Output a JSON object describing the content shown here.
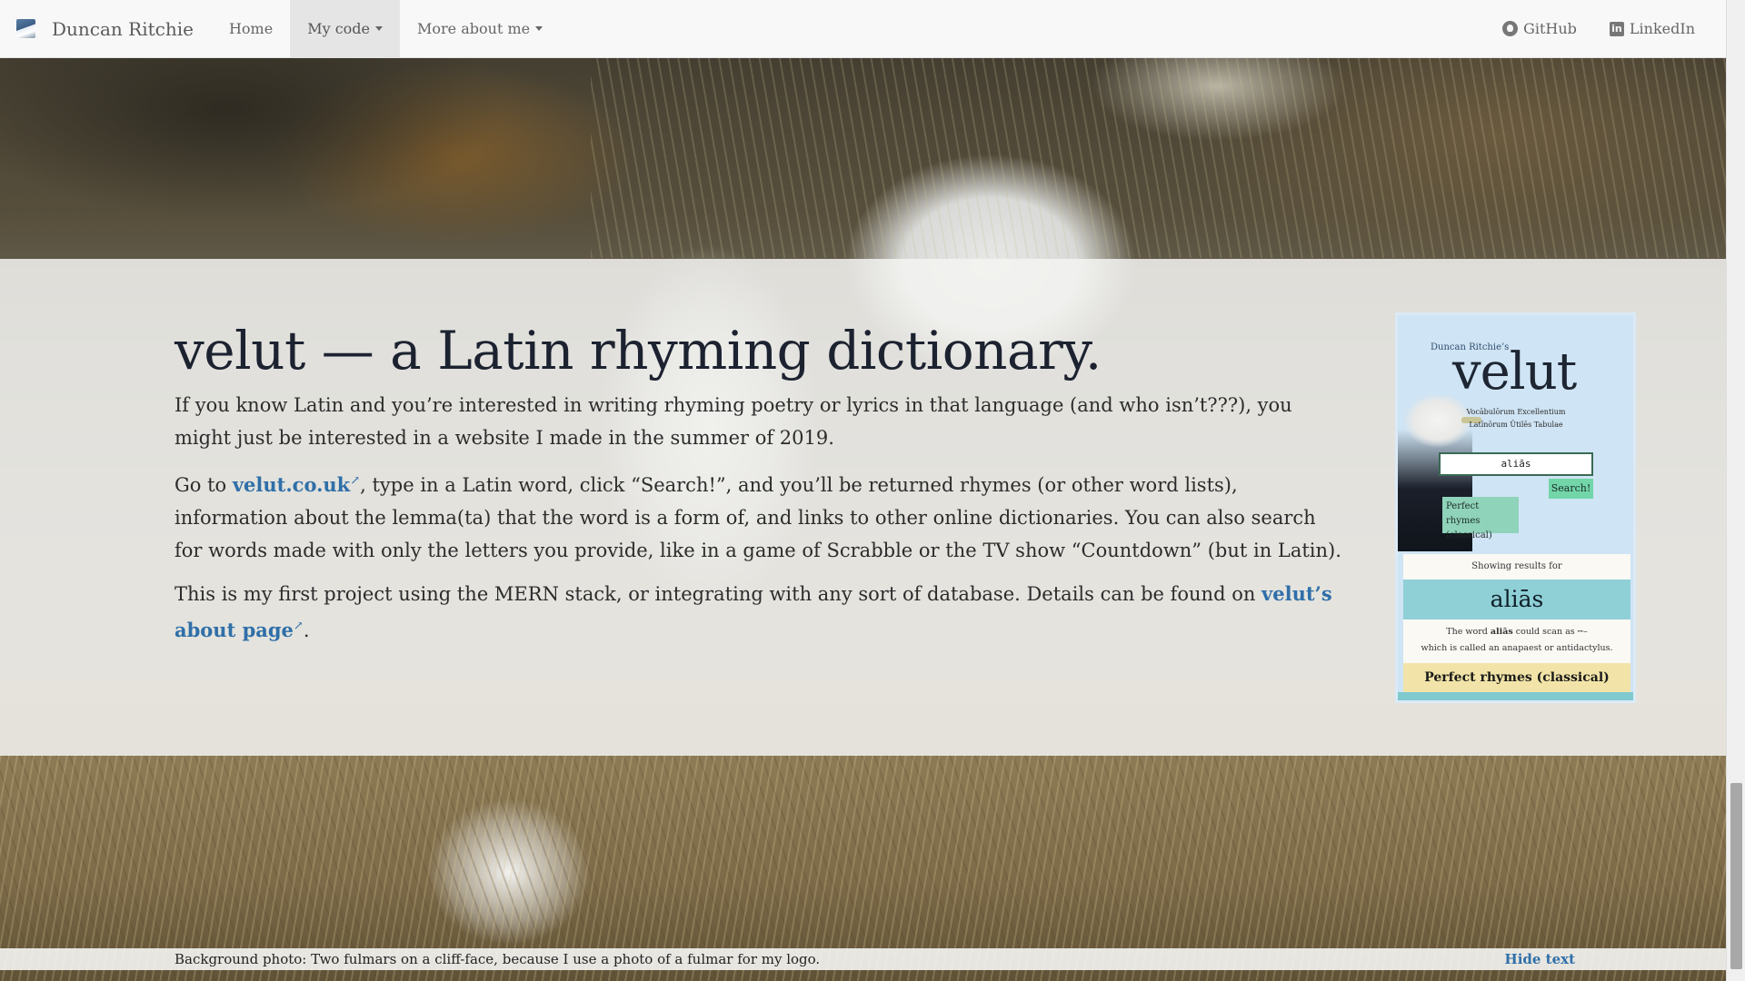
{
  "navbar": {
    "brand": "Duncan Ritchie",
    "items": [
      {
        "label": "Home"
      },
      {
        "label": "My code"
      },
      {
        "label": "More about me"
      }
    ],
    "right": [
      {
        "label": "GitHub",
        "icon": "github-icon"
      },
      {
        "label": "LinkedIn",
        "icon": "linkedin-icon"
      }
    ]
  },
  "main": {
    "title": "velut — a Latin rhyming dictionary.",
    "p1": "If you know Latin and you’re interested in writing rhyming poetry or lyrics in that language (and who isn’t???), you might just be interested in a website I made in the summer of 2019.",
    "p2_prefix": "Go to ",
    "p2_link": "velut.co.uk",
    "p2_suffix": ", type in a Latin word, click “Search!”, and you’ll be returned rhymes (or other word lists), information about the lemma(ta) that the word is a form of, and links to other online dictionaries. You can also search for words made with only the letters you provide, like in a game of Scrabble or the TV show “Countdown” (but in Latin).",
    "p3_prefix": "This is my first project using the MERN stack, or integrating with any sort of database. Details can be found on ",
    "p3_link": "velut’s about page",
    "p3_suffix": ".",
    "external_icon": "↗"
  },
  "preview": {
    "small_label": "Duncan Ritchie’s",
    "logo": "velut",
    "subtitle_1": "Vocābulōrum Excellentium",
    "subtitle_2": "Latīnōrum Ūtilēs Tabulae",
    "input_value": "aliās",
    "search_label": "Search!",
    "option_label_1": "Perfect rhymes",
    "option_label_2": "(classical)",
    "showing": "Showing results for",
    "word": "aliās",
    "scan_1_prefix": "The word ",
    "scan_1_word": "aliās",
    "scan_1_suffix": " could scan as ⏑⏑–",
    "scan_2": "which is called an anapaest or antidactylus.",
    "rhymes_heading": "Perfect rhymes (classical)"
  },
  "caption": {
    "text": "Background photo: Two fulmars on a cliff-face, because I use a photo of a fulmar for my logo.",
    "hide_label": "Hide text"
  }
}
